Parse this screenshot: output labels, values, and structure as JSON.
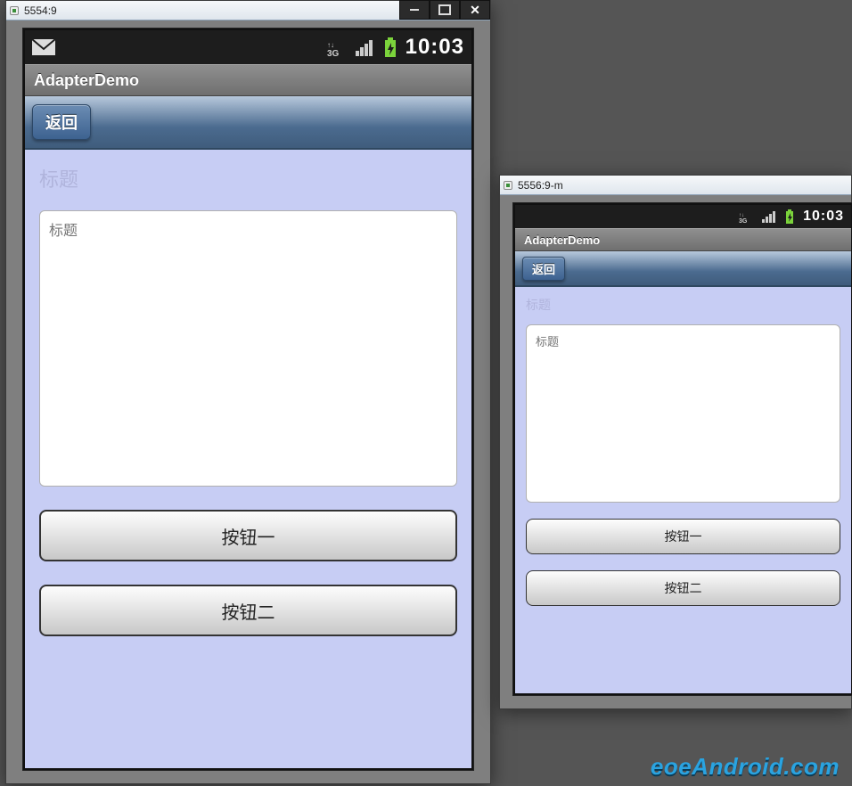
{
  "windows": {
    "primary": {
      "title": "5554:9",
      "minimize": "_",
      "maximize": "□",
      "close": "✕"
    },
    "secondary": {
      "title": "5556:9-m"
    }
  },
  "status": {
    "time": "10:03",
    "network_icon": "3G",
    "signal_icon": "signal",
    "battery_icon": "battery-charging",
    "mail_icon": "mail"
  },
  "app": {
    "title": "AdapterDemo",
    "back_label": "返回",
    "field_placeholder": "标题",
    "field_value": "",
    "buttons": [
      "按钮一",
      "按钮二"
    ]
  },
  "watermark": "eoeAndroid.com",
  "colors": {
    "content_bg": "#c7cdf4",
    "navbar_from": "#b7c8dc",
    "navbar_to": "#3f5c7c",
    "back_btn_from": "#6b8cb3",
    "back_btn_to": "#3d6290"
  }
}
